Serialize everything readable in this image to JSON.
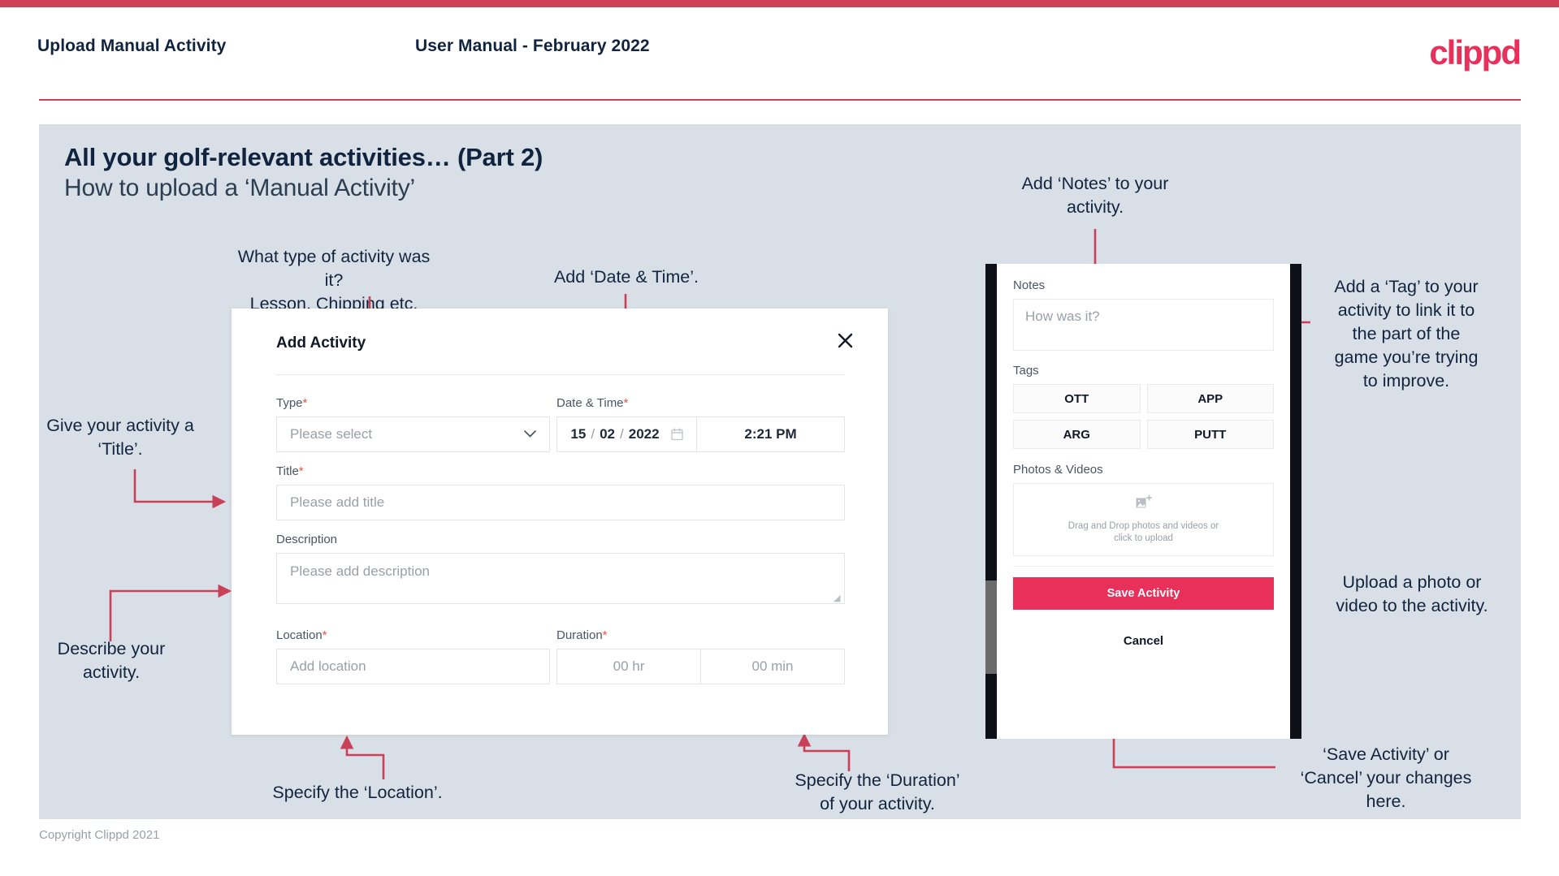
{
  "header": {
    "left_title": "Upload Manual Activity",
    "center_title": "User Manual - February 2022",
    "logo": "clippd"
  },
  "slide": {
    "title": "All your golf-relevant activities… (Part 2)",
    "subtitle": "How to upload a ‘Manual Activity’"
  },
  "annotations": {
    "type": "What type of activity was it?\nLesson, Chipping etc.",
    "datetime": "Add ‘Date & Time’.",
    "title": "Give your activity a\n‘Title’.",
    "description": "Describe your\nactivity.",
    "location": "Specify the ‘Location’.",
    "duration": "Specify the ‘Duration’\nof your activity.",
    "notes": "Add ‘Notes’ to your\nactivity.",
    "tags": "Add a ‘Tag’ to your\nactivity to link it to\nthe part of the\ngame you’re trying\nto improve.",
    "upload": "Upload a photo or\nvideo to the activity.",
    "save_cancel": "‘Save Activity’ or\n‘Cancel’ your changes\nhere."
  },
  "dialog": {
    "title": "Add Activity",
    "close_icon": "close-icon",
    "fields": {
      "type": {
        "label": "Type",
        "required": "*",
        "placeholder": "Please select",
        "chevron": "chevron-down-icon"
      },
      "datetime": {
        "label": "Date & Time",
        "required": "*",
        "day": "15",
        "month": "02",
        "year": "2022",
        "sep": "/",
        "time": "2:21 PM",
        "calendar_icon": "calendar-icon"
      },
      "title": {
        "label": "Title",
        "required": "*",
        "placeholder": "Please add title"
      },
      "description": {
        "label": "Description",
        "required": "",
        "placeholder": "Please add description"
      },
      "location": {
        "label": "Location",
        "required": "*",
        "placeholder": "Add location"
      },
      "duration": {
        "label": "Duration",
        "required": "*",
        "hours_placeholder": "00 hr",
        "minutes_placeholder": "00 min"
      }
    }
  },
  "phone": {
    "notes_label": "Notes",
    "notes_placeholder": "How was it?",
    "tags_label": "Tags",
    "tags": [
      "OTT",
      "APP",
      "ARG",
      "PUTT"
    ],
    "photos_label": "Photos & Videos",
    "dropzone_line1": "Drag and Drop photos and videos or",
    "dropzone_line2": "click to upload",
    "dropzone_icon": "add-image-icon",
    "save_label": "Save Activity",
    "cancel_label": "Cancel"
  },
  "footer": {
    "copyright": "Copyright Clippd 2021"
  },
  "colors": {
    "brand_pink": "#e8305a",
    "top_bar": "#cf4056",
    "slide_bg": "#d9dfe6",
    "heading": "#11243f",
    "arrow": "#c94059"
  }
}
